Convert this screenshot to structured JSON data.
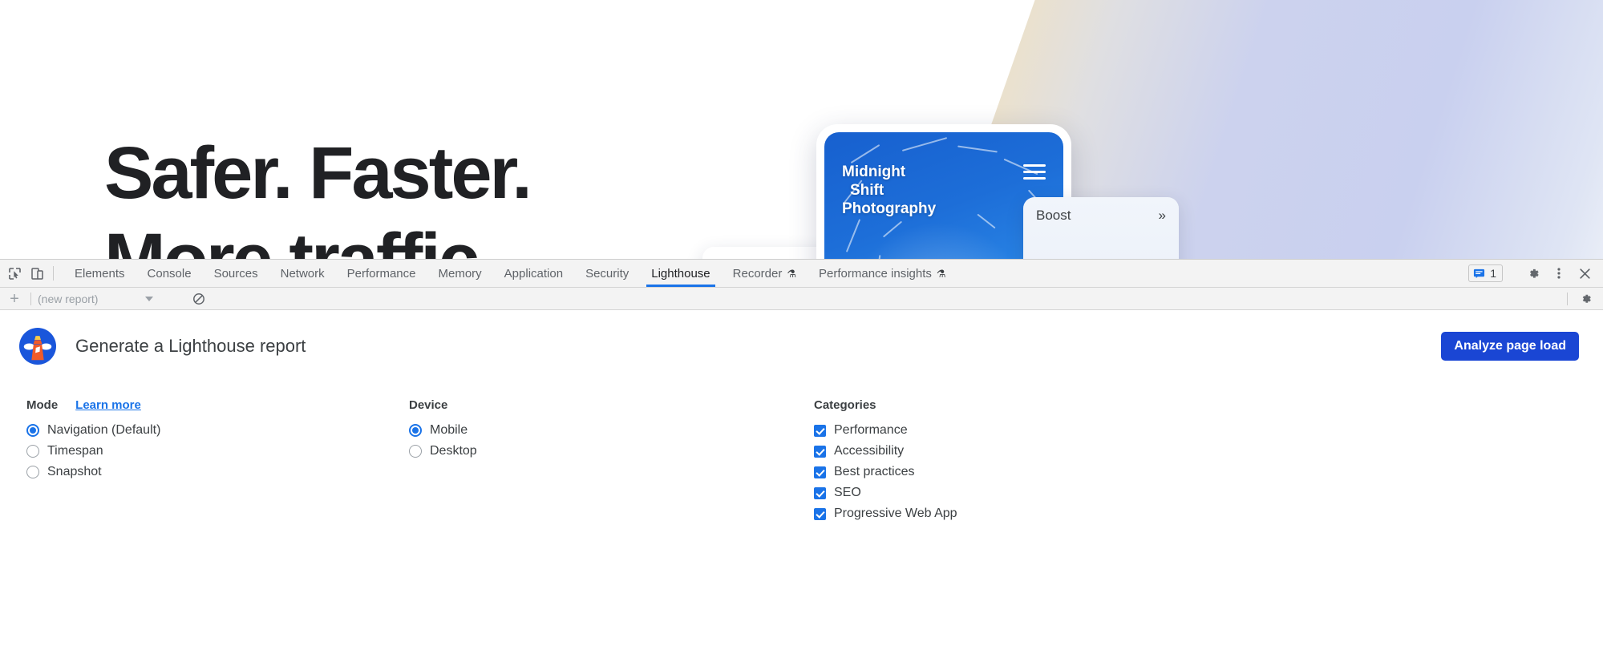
{
  "webpage": {
    "headline_line1": "Safer. Faster.",
    "headline_line2": "More traffic",
    "phone": {
      "brand_line1": "Midnight",
      "brand_line2": "Shift",
      "brand_line3": "Photography",
      "menu_icon": "hamburger-menu-icon"
    },
    "boost_card": {
      "label": "Boost",
      "expand_icon": "double-chevron-right-icon",
      "gauge_color": "#0f9d2f"
    },
    "gradient_colors": [
      "#f5e3bc",
      "#ccd2ee",
      "#eff2f9"
    ]
  },
  "devtools": {
    "left_tools": [
      {
        "name": "inspect-element-icon",
        "title": "Inspect element"
      },
      {
        "name": "device-toolbar-icon",
        "title": "Toggle device toolbar"
      }
    ],
    "tabs": [
      {
        "label": "Elements",
        "active": false,
        "experimental": false
      },
      {
        "label": "Console",
        "active": false,
        "experimental": false
      },
      {
        "label": "Sources",
        "active": false,
        "experimental": false
      },
      {
        "label": "Network",
        "active": false,
        "experimental": false
      },
      {
        "label": "Performance",
        "active": false,
        "experimental": false
      },
      {
        "label": "Memory",
        "active": false,
        "experimental": false
      },
      {
        "label": "Application",
        "active": false,
        "experimental": false
      },
      {
        "label": "Security",
        "active": false,
        "experimental": false
      },
      {
        "label": "Lighthouse",
        "active": true,
        "experimental": false
      },
      {
        "label": "Recorder",
        "active": false,
        "experimental": true
      },
      {
        "label": "Performance insights",
        "active": false,
        "experimental": true
      }
    ],
    "experimental_glyph": "⚗",
    "issues": {
      "icon": "issues-message-icon",
      "count": "1"
    },
    "right_buttons": [
      {
        "name": "settings-gear-icon"
      },
      {
        "name": "more-options-icon"
      },
      {
        "name": "close-devtools-icon"
      }
    ],
    "toolbar2": {
      "add_label": "+",
      "report_name": "(new report)",
      "clear_icon": "clear-all-icon",
      "settings_icon": "settings-gear-icon"
    }
  },
  "lighthouse": {
    "logo_name": "lighthouse-logo",
    "title": "Generate a Lighthouse report",
    "analyze_button": "Analyze page load",
    "mode": {
      "heading": "Mode",
      "learn_more": "Learn more",
      "options": [
        {
          "label": "Navigation (Default)",
          "selected": true
        },
        {
          "label": "Timespan",
          "selected": false
        },
        {
          "label": "Snapshot",
          "selected": false
        }
      ]
    },
    "device": {
      "heading": "Device",
      "options": [
        {
          "label": "Mobile",
          "selected": true
        },
        {
          "label": "Desktop",
          "selected": false
        }
      ]
    },
    "categories": {
      "heading": "Categories",
      "options": [
        {
          "label": "Performance",
          "checked": true
        },
        {
          "label": "Accessibility",
          "checked": true
        },
        {
          "label": "Best practices",
          "checked": true
        },
        {
          "label": "SEO",
          "checked": true
        },
        {
          "label": "Progressive Web App",
          "checked": true
        }
      ]
    }
  },
  "colors": {
    "accent_blue": "#1a73e8",
    "button_blue": "#1a46d4",
    "toolbar_bg": "#f3f3f3",
    "text": "#3c4043"
  }
}
